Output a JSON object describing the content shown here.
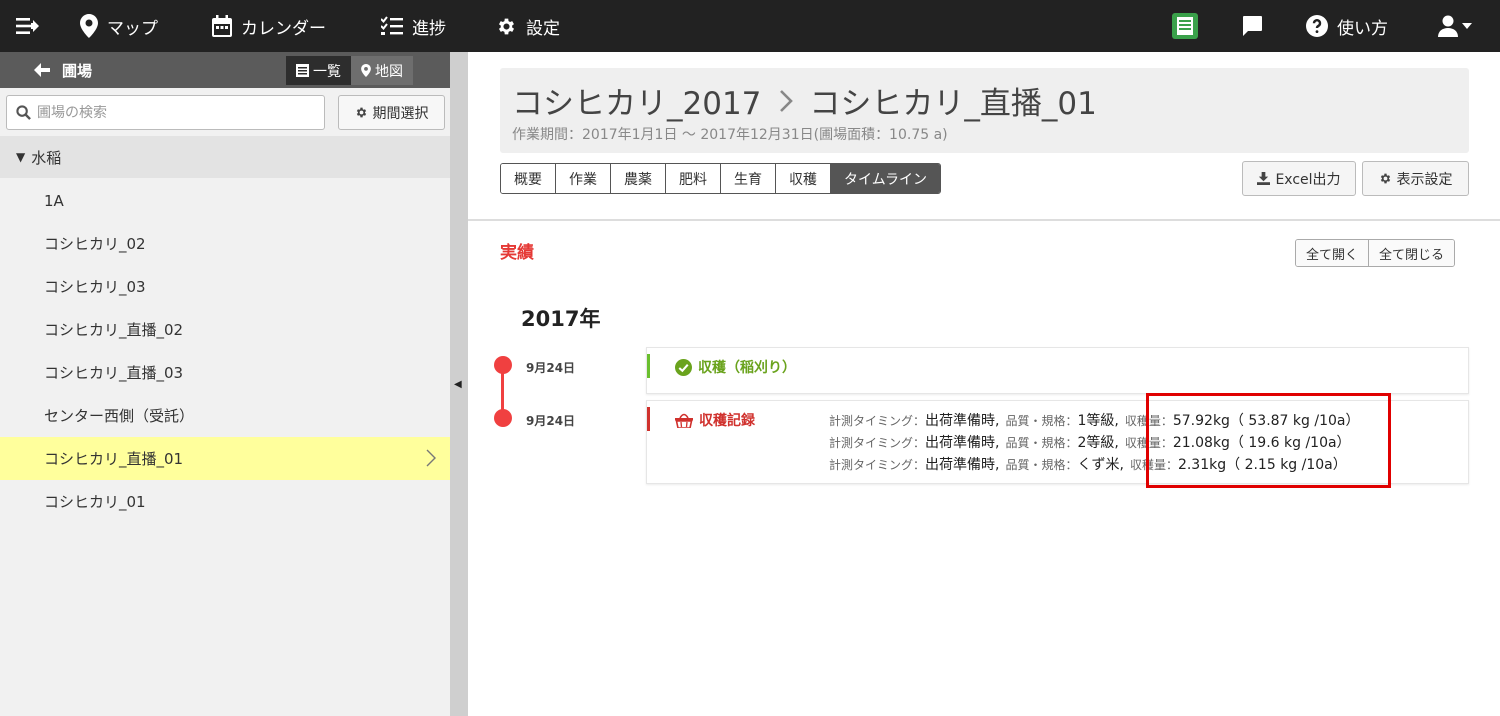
{
  "nav": {
    "map": "マップ",
    "calendar": "カレンダー",
    "progress": "進捗",
    "settings": "設定",
    "help": "使い方"
  },
  "sidebar": {
    "title": "圃場",
    "view_list": "一覧",
    "view_map": "地図",
    "search_placeholder": "圃場の検索",
    "period_button": "期間選択",
    "group": "水稲",
    "items": [
      {
        "label": "1A"
      },
      {
        "label": "コシヒカリ_02"
      },
      {
        "label": "コシヒカリ_03"
      },
      {
        "label": "コシヒカリ_直播_02"
      },
      {
        "label": "コシヒカリ_直播_03"
      },
      {
        "label": "センター西側（受託）"
      },
      {
        "label": "コシヒカリ_直播_01"
      },
      {
        "label": "コシヒカリ_01"
      }
    ],
    "selected_index": 6
  },
  "main": {
    "breadcrumb_parent": "コシヒカリ_2017",
    "breadcrumb_current": "コシヒカリ_直播_01",
    "subtitle": "作業期間：2017年1月1日 ～ 2017年12月31日(圃場面積：10.75 a)",
    "tabs": [
      "概要",
      "作業",
      "農薬",
      "肥料",
      "生育",
      "収穫",
      "タイムライン"
    ],
    "active_tab": 6,
    "excel_button": "Excel出力",
    "display_settings_button": "表示設定",
    "results_heading": "実績",
    "expand_all": "全て開く",
    "collapse_all": "全て閉じる",
    "year": "2017年",
    "events": [
      {
        "date": "9月24日",
        "title": "収穫（稲刈り）"
      },
      {
        "date": "9月24日",
        "title": "収穫記録"
      }
    ],
    "records": [
      {
        "timing_label": "計測タイミング：",
        "timing": "出荷準備時,",
        "grade_label": "品質・規格：",
        "grade": "1等級,",
        "amount_label": "収穫量：",
        "amount": "57.92kg（ 53.87 kg /10a）"
      },
      {
        "timing_label": "計測タイミング：",
        "timing": "出荷準備時,",
        "grade_label": "品質・規格：",
        "grade": "2等級,",
        "amount_label": "収穫量：",
        "amount": "21.08kg（ 19.6 kg /10a）"
      },
      {
        "timing_label": "計測タイミング：",
        "timing": "出荷準備時,",
        "grade_label": "品質・規格：",
        "grade": "くず米,",
        "amount_label": "収穫量：",
        "amount": "2.31kg（ 2.15 kg /10a）"
      }
    ]
  },
  "colors": {
    "topbar": "#222222",
    "accent_red": "#e53935",
    "harvest_green": "#6aa31d",
    "selected_row": "#ffff9c",
    "highlight_box": "#e00000"
  }
}
